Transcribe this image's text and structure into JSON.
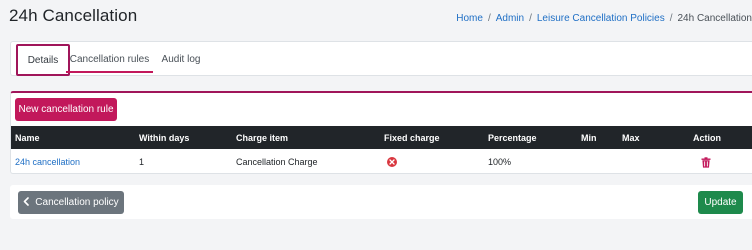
{
  "page": {
    "title": "24h Cancellation"
  },
  "breadcrumb": {
    "items": [
      "Home",
      "Admin",
      "Leisure Cancellation Policies"
    ],
    "current": "24h Cancellation",
    "separator": "/"
  },
  "tabs": [
    {
      "label": "Details",
      "state": "focused"
    },
    {
      "label": "Cancellation rules",
      "state": "active"
    },
    {
      "label": "Audit log",
      "state": "normal"
    }
  ],
  "rules": {
    "new_button_label": "New cancellation rule",
    "columns": [
      "Name",
      "Within days",
      "Charge item",
      "Fixed charge",
      "Percentage",
      "Min",
      "Max",
      "Action"
    ],
    "rows": [
      {
        "name": "24h cancellation",
        "within_days": "1",
        "charge_item": "Cancellation Charge",
        "fixed_charge_icon": "x-circle-icon",
        "percentage": "100%",
        "min": "",
        "max": "",
        "action_icon": "trash-icon"
      }
    ]
  },
  "footer": {
    "back_label": "Cancellation policy",
    "back_icon": "chevron-left-icon",
    "update_label": "Update"
  },
  "colors": {
    "brand": "#c2185b",
    "link": "#1f6fc5",
    "header_bg": "#212529",
    "update": "#1e8a4c",
    "secondary": "#6c757d",
    "danger": "#d9363e"
  }
}
